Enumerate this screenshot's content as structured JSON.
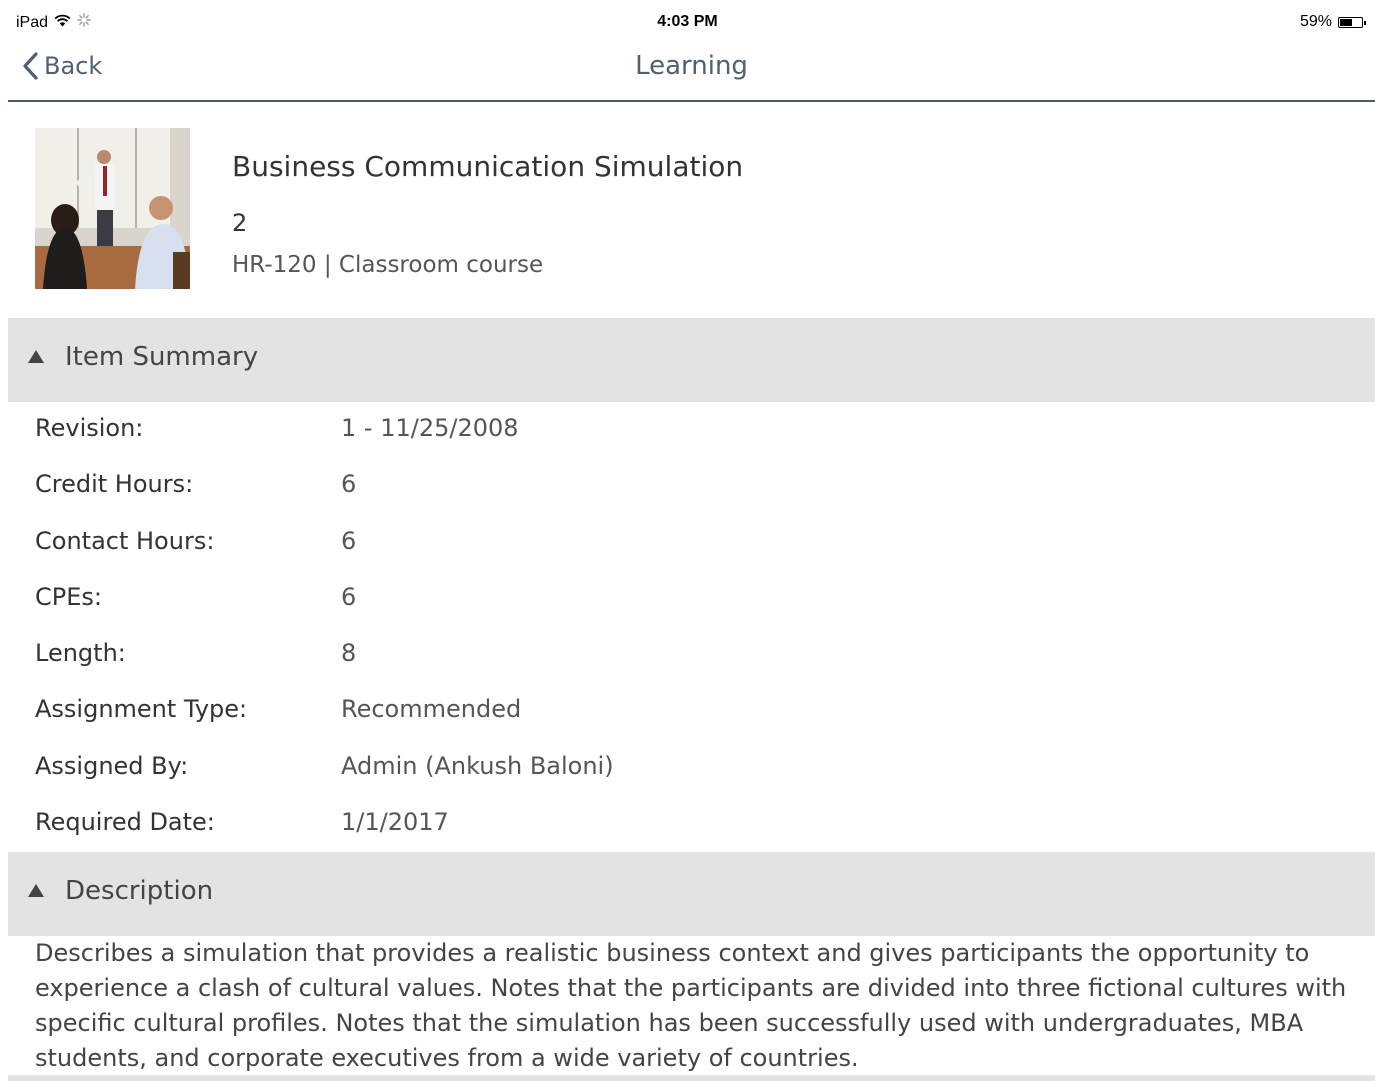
{
  "status_bar": {
    "device": "iPad",
    "time": "4:03 PM",
    "battery_percent": "59%",
    "battery_level": 0.59,
    "icons": [
      "wifi-icon",
      "activity-spinner-icon",
      "battery-icon"
    ]
  },
  "nav": {
    "back_label": "Back",
    "title": "Learning"
  },
  "course": {
    "title": "Business Communication Simulation",
    "number": "2",
    "meta": "HR-120 | Classroom course"
  },
  "summary": {
    "header": "Item Summary",
    "rows": [
      {
        "label": "Revision:",
        "value": "1 - 11/25/2008"
      },
      {
        "label": "Credit Hours:",
        "value": "6"
      },
      {
        "label": "Contact Hours:",
        "value": "6"
      },
      {
        "label": "CPEs:",
        "value": "6"
      },
      {
        "label": "Length:",
        "value": "8"
      },
      {
        "label": "Assignment Type:",
        "value": "Recommended"
      },
      {
        "label": "Assigned By:",
        "value": "Admin (Ankush Baloni)"
      },
      {
        "label": "Required Date:",
        "value": "1/1/2017"
      }
    ]
  },
  "description": {
    "header": "Description",
    "text": "Describes a simulation that provides a realistic business context and gives participants the opportunity to experience a clash of cultural values. Notes that the participants are divided into three fictional cultures with specific cultural profiles. Notes that the simulation has been successfully used with undergraduates, MBA students, and corporate executives from a wide variety of countries."
  },
  "colors": {
    "nav_accent": "#4e6073",
    "section_background": "#e3e3e3",
    "divider": "#4a5a68"
  }
}
